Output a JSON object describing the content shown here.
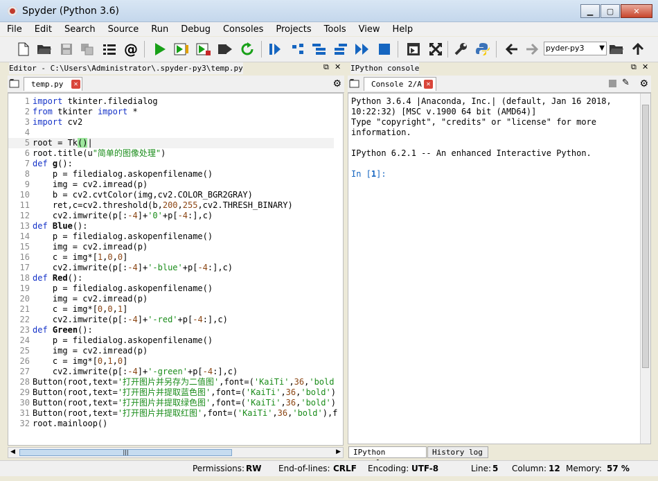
{
  "window": {
    "title": "Spyder (Python 3.6)"
  },
  "menu": [
    "File",
    "Edit",
    "Search",
    "Source",
    "Run",
    "Debug",
    "Consoles",
    "Projects",
    "Tools",
    "View",
    "Help"
  ],
  "toolbar": {
    "working_dir": "pyder-py3"
  },
  "editor": {
    "pane_title": "Editor - C:\\Users\\Administrator\\.spyder-py3\\temp.py",
    "tab_label": "temp.py",
    "lines": [
      "import tkinter.filedialog",
      "from tkinter import *",
      "import cv2",
      "",
      "root = Tk()",
      "root.title(u\"简单的图像处理\")",
      "def g():",
      "    p = filedialog.askopenfilename()",
      "    img = cv2.imread(p)",
      "    b = cv2.cvtColor(img,cv2.COLOR_BGR2GRAY)",
      "    ret,c=cv2.threshold(b,200,255,cv2.THRESH_BINARY)",
      "    cv2.imwrite(p[:-4]+'0'+p[-4:],c)",
      "def Blue():",
      "    p = filedialog.askopenfilename()",
      "    img = cv2.imread(p)",
      "    c = img*[1,0,0]",
      "    cv2.imwrite(p[:-4]+'-blue'+p[-4:],c)",
      "def Red():",
      "    p = filedialog.askopenfilename()",
      "    img = cv2.imread(p)",
      "    c = img*[0,0,1]",
      "    cv2.imwrite(p[:-4]+'-red'+p[-4:],c)",
      "def Green():",
      "    p = filedialog.askopenfilename()",
      "    img = cv2.imread(p)",
      "    c = img*[0,1,0]",
      "    cv2.imwrite(p[:-4]+'-green'+p[-4:],c)",
      "Button(root,text='打开图片并另存为二值图',font=('KaiTi',36,'bold",
      "Button(root,text='打开图片并提取蓝色图',font=('KaiTi',36,'bold')",
      "Button(root,text='打开图片并提取绿色图',font=('KaiTi',36,'bold')",
      "Button(root,text='打开图片并提取红图',font=('KaiTi',36,'bold'),f",
      "root.mainloop()"
    ],
    "current_line": 5
  },
  "console": {
    "pane_title": "IPython console",
    "tab_label": "Console 2/A",
    "lines": [
      "Python 3.6.4 |Anaconda, Inc.| (default, Jan 16 2018,",
      "10:22:32) [MSC v.1900 64 bit (AMD64)]",
      "Type \"copyright\", \"credits\" or \"license\" for more",
      "information.",
      "",
      "IPython 6.2.1 -- An enhanced Interactive Python.",
      "",
      ""
    ],
    "prompt_in": "In [",
    "prompt_num": "1",
    "prompt_end": "]:",
    "bottom_tabs": [
      "IPython console",
      "History log"
    ]
  },
  "statusbar": {
    "permissions_label": "Permissions:",
    "permissions_value": "RW",
    "eol_label": "End-of-lines:",
    "eol_value": "CRLF",
    "encoding_label": "Encoding:",
    "encoding_value": "UTF-8",
    "line_label": "Line:",
    "line_value": "5",
    "column_label": "Column:",
    "column_value": "12",
    "memory_label": "Memory:",
    "memory_value": "57 %"
  },
  "colors": {
    "keyword": "#1432c8",
    "string": "#1a8c1a",
    "number": "#8b4513",
    "run_green": "#18a018",
    "accent_blue": "#1565c0"
  }
}
